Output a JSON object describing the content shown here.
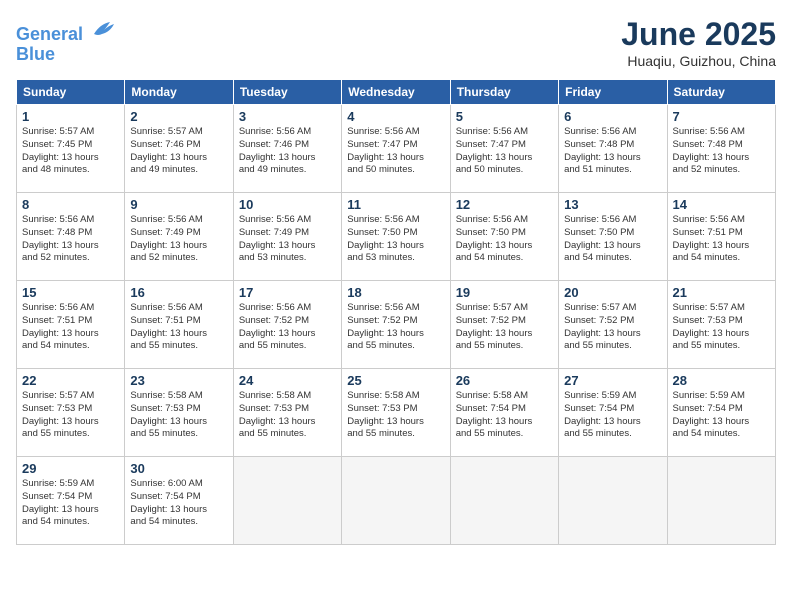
{
  "header": {
    "logo_line1": "General",
    "logo_line2": "Blue",
    "month": "June 2025",
    "location": "Huaqiu, Guizhou, China"
  },
  "weekdays": [
    "Sunday",
    "Monday",
    "Tuesday",
    "Wednesday",
    "Thursday",
    "Friday",
    "Saturday"
  ],
  "weeks": [
    [
      {
        "day": "1",
        "info": "Sunrise: 5:57 AM\nSunset: 7:45 PM\nDaylight: 13 hours\nand 48 minutes."
      },
      {
        "day": "2",
        "info": "Sunrise: 5:57 AM\nSunset: 7:46 PM\nDaylight: 13 hours\nand 49 minutes."
      },
      {
        "day": "3",
        "info": "Sunrise: 5:56 AM\nSunset: 7:46 PM\nDaylight: 13 hours\nand 49 minutes."
      },
      {
        "day": "4",
        "info": "Sunrise: 5:56 AM\nSunset: 7:47 PM\nDaylight: 13 hours\nand 50 minutes."
      },
      {
        "day": "5",
        "info": "Sunrise: 5:56 AM\nSunset: 7:47 PM\nDaylight: 13 hours\nand 50 minutes."
      },
      {
        "day": "6",
        "info": "Sunrise: 5:56 AM\nSunset: 7:48 PM\nDaylight: 13 hours\nand 51 minutes."
      },
      {
        "day": "7",
        "info": "Sunrise: 5:56 AM\nSunset: 7:48 PM\nDaylight: 13 hours\nand 52 minutes."
      }
    ],
    [
      {
        "day": "8",
        "info": "Sunrise: 5:56 AM\nSunset: 7:48 PM\nDaylight: 13 hours\nand 52 minutes."
      },
      {
        "day": "9",
        "info": "Sunrise: 5:56 AM\nSunset: 7:49 PM\nDaylight: 13 hours\nand 52 minutes."
      },
      {
        "day": "10",
        "info": "Sunrise: 5:56 AM\nSunset: 7:49 PM\nDaylight: 13 hours\nand 53 minutes."
      },
      {
        "day": "11",
        "info": "Sunrise: 5:56 AM\nSunset: 7:50 PM\nDaylight: 13 hours\nand 53 minutes."
      },
      {
        "day": "12",
        "info": "Sunrise: 5:56 AM\nSunset: 7:50 PM\nDaylight: 13 hours\nand 54 minutes."
      },
      {
        "day": "13",
        "info": "Sunrise: 5:56 AM\nSunset: 7:50 PM\nDaylight: 13 hours\nand 54 minutes."
      },
      {
        "day": "14",
        "info": "Sunrise: 5:56 AM\nSunset: 7:51 PM\nDaylight: 13 hours\nand 54 minutes."
      }
    ],
    [
      {
        "day": "15",
        "info": "Sunrise: 5:56 AM\nSunset: 7:51 PM\nDaylight: 13 hours\nand 54 minutes."
      },
      {
        "day": "16",
        "info": "Sunrise: 5:56 AM\nSunset: 7:51 PM\nDaylight: 13 hours\nand 55 minutes."
      },
      {
        "day": "17",
        "info": "Sunrise: 5:56 AM\nSunset: 7:52 PM\nDaylight: 13 hours\nand 55 minutes."
      },
      {
        "day": "18",
        "info": "Sunrise: 5:56 AM\nSunset: 7:52 PM\nDaylight: 13 hours\nand 55 minutes."
      },
      {
        "day": "19",
        "info": "Sunrise: 5:57 AM\nSunset: 7:52 PM\nDaylight: 13 hours\nand 55 minutes."
      },
      {
        "day": "20",
        "info": "Sunrise: 5:57 AM\nSunset: 7:52 PM\nDaylight: 13 hours\nand 55 minutes."
      },
      {
        "day": "21",
        "info": "Sunrise: 5:57 AM\nSunset: 7:53 PM\nDaylight: 13 hours\nand 55 minutes."
      }
    ],
    [
      {
        "day": "22",
        "info": "Sunrise: 5:57 AM\nSunset: 7:53 PM\nDaylight: 13 hours\nand 55 minutes."
      },
      {
        "day": "23",
        "info": "Sunrise: 5:58 AM\nSunset: 7:53 PM\nDaylight: 13 hours\nand 55 minutes."
      },
      {
        "day": "24",
        "info": "Sunrise: 5:58 AM\nSunset: 7:53 PM\nDaylight: 13 hours\nand 55 minutes."
      },
      {
        "day": "25",
        "info": "Sunrise: 5:58 AM\nSunset: 7:53 PM\nDaylight: 13 hours\nand 55 minutes."
      },
      {
        "day": "26",
        "info": "Sunrise: 5:58 AM\nSunset: 7:54 PM\nDaylight: 13 hours\nand 55 minutes."
      },
      {
        "day": "27",
        "info": "Sunrise: 5:59 AM\nSunset: 7:54 PM\nDaylight: 13 hours\nand 55 minutes."
      },
      {
        "day": "28",
        "info": "Sunrise: 5:59 AM\nSunset: 7:54 PM\nDaylight: 13 hours\nand 54 minutes."
      }
    ],
    [
      {
        "day": "29",
        "info": "Sunrise: 5:59 AM\nSunset: 7:54 PM\nDaylight: 13 hours\nand 54 minutes."
      },
      {
        "day": "30",
        "info": "Sunrise: 6:00 AM\nSunset: 7:54 PM\nDaylight: 13 hours\nand 54 minutes."
      },
      null,
      null,
      null,
      null,
      null
    ]
  ]
}
